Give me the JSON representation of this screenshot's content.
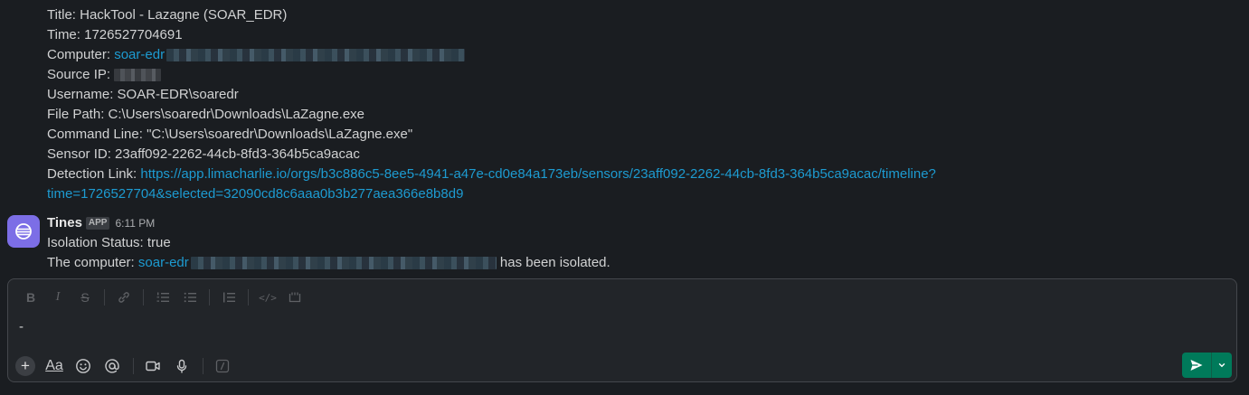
{
  "alert": {
    "title_label": "Title:",
    "title_value": "HackTool - Lazagne (SOAR_EDR)",
    "time_label": "Time:",
    "time_value": "1726527704691",
    "computer_label": "Computer:",
    "computer_value": "soar-edr",
    "source_ip_label": "Source IP:",
    "username_label": "Username:",
    "username_value": "SOAR-EDR\\soaredr",
    "file_path_label": "File Path:",
    "file_path_value": "C:\\Users\\soaredr\\Downloads\\LaZagne.exe",
    "command_line_label": "Command Line:",
    "command_line_value": "\"C:\\Users\\soaredr\\Downloads\\LaZagne.exe\"",
    "sensor_id_label": "Sensor ID:",
    "sensor_id_value": "23aff092-2262-44cb-8fd3-364b5ca9acac",
    "detection_link_label": "Detection Link:",
    "detection_link_line1": "https://app.limacharlie.io/orgs/b3c886c5-8ee5-4941-a47e-cd0e84a173eb/sensors/23aff092-2262-44cb-8fd3-364b5ca9acac/timeline?",
    "detection_link_line2": "time=1726527704&selected=32090cd8c6aaa0b3b277aea366e8b8d9"
  },
  "tines_message": {
    "sender": "Tines",
    "badge": "APP",
    "time": "6:11 PM",
    "isolation_status": "Isolation Status: true",
    "computer_prefix": "The computer:",
    "computer_link": "soar-edr",
    "computer_suffix": "has been isolated."
  },
  "composer": {
    "input_value": "-"
  },
  "colors": {
    "background": "#1a1d21",
    "link": "#1d9bd1",
    "send_button": "#007a5a",
    "avatar": "#7c6ee6"
  }
}
